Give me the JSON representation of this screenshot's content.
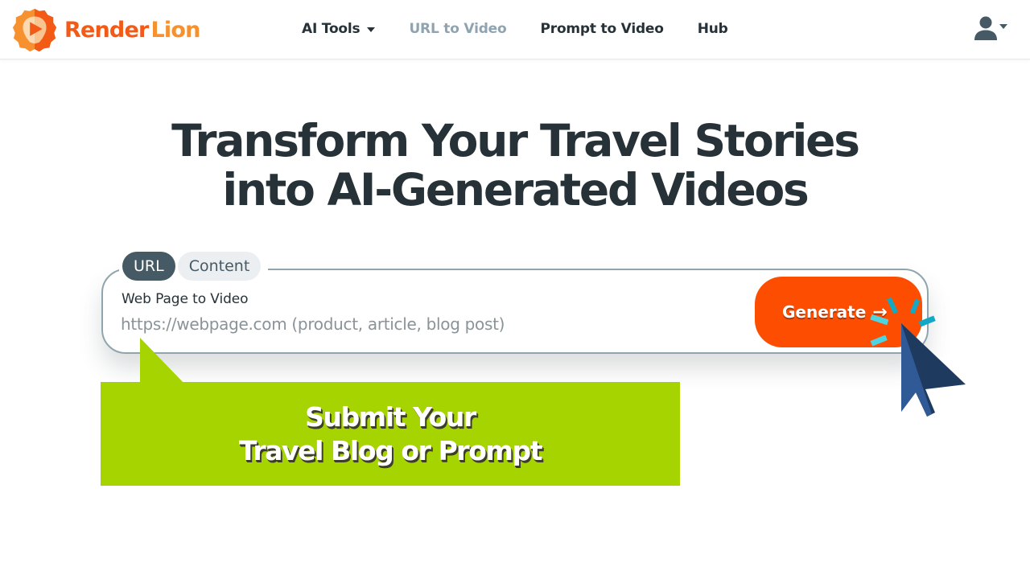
{
  "brand": {
    "name_part1": "Render",
    "name_part2": "Lion",
    "logo_icon": "lion-play-icon",
    "primary_color": "#f25a16",
    "secondary_color": "#f7902e"
  },
  "nav": {
    "items": [
      {
        "label": "AI Tools",
        "has_dropdown": true,
        "active": false
      },
      {
        "label": "URL to Video",
        "has_dropdown": false,
        "active": true
      },
      {
        "label": "Prompt to Video",
        "has_dropdown": false,
        "active": false
      },
      {
        "label": "Hub",
        "has_dropdown": false,
        "active": false
      }
    ],
    "user_menu_icon": "user-icon"
  },
  "hero": {
    "headline_line1": "Transform Your Travel Stories",
    "headline_line2": "into AI-Generated Videos"
  },
  "input_card": {
    "tabs": [
      {
        "label": "URL",
        "active": true
      },
      {
        "label": "Content",
        "active": false
      }
    ],
    "field_label": "Web Page to Video",
    "url_value": "",
    "url_placeholder": "https://webpage.com (product, article, blog post)",
    "generate_label": "Generate",
    "generate_icon": "arrow-right-icon",
    "generate_color": "#fd4d00"
  },
  "callout": {
    "line1": "Submit Your",
    "line2": "Travel Blog or Prompt",
    "color": "#a6d400"
  },
  "decorations": {
    "cursor_icon": "mouse-pointer-click-icon"
  }
}
